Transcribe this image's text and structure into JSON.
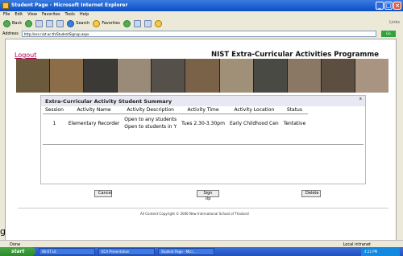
{
  "window": {
    "title": "Student Page - Microsoft Internet Explorer"
  },
  "menu": [
    "File",
    "Edit",
    "View",
    "Favorites",
    "Tools",
    "Help"
  ],
  "toolbar": {
    "back": "Back",
    "search": "Search",
    "favorites": "Favorites",
    "links": "Links"
  },
  "address": {
    "label": "Address",
    "url": "http://ecs.nist.ac.th/StudentSignup.aspx",
    "go": "Go"
  },
  "header": {
    "logout": "Logout",
    "program_title": "NIST Extra-Curricular Activities Programme"
  },
  "summary": {
    "title": "Extra-Curricular Activity Student Summary",
    "close": "x",
    "columns": [
      "Session",
      "Activity Name",
      "Activity Description",
      "Activity Time",
      "Activity Location",
      "Status"
    ],
    "rows": [
      {
        "session": "1",
        "name": "Elementary Recorder",
        "desc1": "Open to any students",
        "desc2": "Open to students in Y",
        "time": "Tues 2.30-3.30pm",
        "location": "Early Childhood Cen",
        "status": "Tentative"
      }
    ]
  },
  "buttons": {
    "cancel": "Cancel",
    "signup": "Sign Up",
    "delete": "Delete"
  },
  "footer": {
    "copyright": "All Content Copyright © 2006 New International School of Thailand"
  },
  "stray_text": "g",
  "status": {
    "left": "Done",
    "zone": "Local intranet"
  },
  "taskbar": {
    "start": "start",
    "tasks": [
      "06-07 Lit",
      "ECA Presentation",
      "Student Page - Micr..."
    ],
    "clock": "4:22 PM"
  }
}
